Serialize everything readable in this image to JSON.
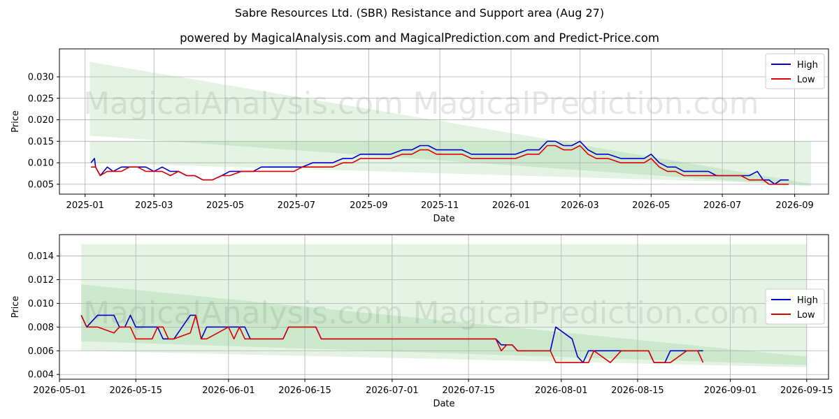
{
  "title": "Sabre Resources Ltd. (SBR) Resistance and Support area (Aug 27)",
  "subtitle": "powered by MagicalAnalysis.com and MagicalPrediction.com and Predict-Price.com",
  "watermarks": [
    "MagicalAnalysis.com",
    "MagicalPrediction.com"
  ],
  "colors": {
    "high": "#0000cc",
    "low": "#dd0000",
    "band": "#2ca02c",
    "grid": "#b0b0b0",
    "watermark": "#dddddd"
  },
  "chart_data": [
    {
      "type": "line",
      "xlabel": "Date",
      "ylabel": "Price",
      "x_type": "date",
      "xlim": [
        "2024-12-10",
        "2026-09-30"
      ],
      "ylim": [
        0.0027,
        0.0365
      ],
      "xticks": [
        "2025-01",
        "2025-03",
        "2025-05",
        "2025-07",
        "2025-09",
        "2025-11",
        "2026-01",
        "2026-03",
        "2026-05",
        "2026-07",
        "2026-09"
      ],
      "xtick_dates": [
        "2025-01-01",
        "2025-03-01",
        "2025-05-01",
        "2025-07-01",
        "2025-09-01",
        "2025-11-01",
        "2026-01-01",
        "2026-03-01",
        "2026-05-01",
        "2026-07-01",
        "2026-09-01"
      ],
      "yticks": [
        "0.005",
        "0.010",
        "0.015",
        "0.020",
        "0.025",
        "0.030"
      ],
      "ytick_values": [
        0.005,
        0.01,
        0.015,
        0.02,
        0.025,
        0.03
      ],
      "grid": true,
      "legend_position": "top-right",
      "bands": [
        {
          "x": [
            "2025-01-05",
            "2026-09-15"
          ],
          "upper": [
            0.0335,
            0.0051
          ],
          "lower": [
            0.0163,
            0.0045
          ]
        },
        {
          "x": [
            "2025-01-05",
            "2026-09-15"
          ],
          "upper": [
            0.015,
            0.015
          ],
          "lower": [
            0.01,
            0.005
          ]
        }
      ],
      "series": [
        {
          "name": "High",
          "x": [
            "2025-01-06",
            "2025-01-09",
            "2025-01-10",
            "2025-01-14",
            "2025-01-20",
            "2025-01-25",
            "2025-02-01",
            "2025-02-08",
            "2025-02-15",
            "2025-02-22",
            "2025-03-01",
            "2025-03-08",
            "2025-03-15",
            "2025-03-22",
            "2025-03-29",
            "2025-04-05",
            "2025-04-12",
            "2025-04-20",
            "2025-04-28",
            "2025-05-05",
            "2025-05-15",
            "2025-05-25",
            "2025-06-01",
            "2025-06-08",
            "2025-06-15",
            "2025-06-22",
            "2025-06-29",
            "2025-07-06",
            "2025-07-15",
            "2025-07-25",
            "2025-08-01",
            "2025-08-10",
            "2025-08-18",
            "2025-08-25",
            "2025-09-01",
            "2025-09-10",
            "2025-09-20",
            "2025-09-30",
            "2025-10-08",
            "2025-10-15",
            "2025-10-22",
            "2025-10-29",
            "2025-11-05",
            "2025-11-12",
            "2025-11-20",
            "2025-11-28",
            "2025-12-05",
            "2025-12-15",
            "2025-12-25",
            "2026-01-05",
            "2026-01-15",
            "2026-01-25",
            "2026-02-01",
            "2026-02-08",
            "2026-02-15",
            "2026-02-22",
            "2026-03-01",
            "2026-03-08",
            "2026-03-15",
            "2026-03-25",
            "2026-04-05",
            "2026-04-15",
            "2026-04-25",
            "2026-05-01",
            "2026-05-08",
            "2026-05-15",
            "2026-05-22",
            "2026-05-29",
            "2026-06-05",
            "2026-06-12",
            "2026-06-19",
            "2026-06-26",
            "2026-07-03",
            "2026-07-10",
            "2026-07-17",
            "2026-07-24",
            "2026-07-31",
            "2026-08-05",
            "2026-08-10",
            "2026-08-15",
            "2026-08-20",
            "2026-08-27"
          ],
          "y": [
            0.01,
            0.011,
            0.009,
            0.007,
            0.009,
            0.008,
            0.009,
            0.009,
            0.009,
            0.009,
            0.008,
            0.009,
            0.008,
            0.008,
            0.007,
            0.007,
            0.006,
            0.006,
            0.007,
            0.008,
            0.008,
            0.008,
            0.009,
            0.009,
            0.009,
            0.009,
            0.009,
            0.009,
            0.01,
            0.01,
            0.01,
            0.011,
            0.011,
            0.012,
            0.012,
            0.012,
            0.012,
            0.013,
            0.013,
            0.014,
            0.014,
            0.013,
            0.013,
            0.013,
            0.013,
            0.012,
            0.012,
            0.012,
            0.012,
            0.012,
            0.013,
            0.013,
            0.015,
            0.015,
            0.014,
            0.014,
            0.015,
            0.013,
            0.012,
            0.012,
            0.011,
            0.011,
            0.011,
            0.012,
            0.01,
            0.009,
            0.009,
            0.008,
            0.008,
            0.008,
            0.008,
            0.007,
            0.007,
            0.007,
            0.007,
            0.007,
            0.008,
            0.006,
            0.006,
            0.005,
            0.006,
            0.006
          ]
        },
        {
          "name": "Low",
          "x": [
            "2025-01-06",
            "2025-01-09",
            "2025-01-10",
            "2025-01-14",
            "2025-01-20",
            "2025-01-25",
            "2025-02-01",
            "2025-02-08",
            "2025-02-15",
            "2025-02-22",
            "2025-03-01",
            "2025-03-08",
            "2025-03-15",
            "2025-03-22",
            "2025-03-29",
            "2025-04-05",
            "2025-04-12",
            "2025-04-20",
            "2025-04-28",
            "2025-05-05",
            "2025-05-15",
            "2025-05-25",
            "2025-06-01",
            "2025-06-08",
            "2025-06-15",
            "2025-06-22",
            "2025-06-29",
            "2025-07-06",
            "2025-07-15",
            "2025-07-25",
            "2025-08-01",
            "2025-08-10",
            "2025-08-18",
            "2025-08-25",
            "2025-09-01",
            "2025-09-10",
            "2025-09-20",
            "2025-09-30",
            "2025-10-08",
            "2025-10-15",
            "2025-10-22",
            "2025-10-29",
            "2025-11-05",
            "2025-11-12",
            "2025-11-20",
            "2025-11-28",
            "2025-12-05",
            "2025-12-15",
            "2025-12-25",
            "2026-01-05",
            "2026-01-15",
            "2026-01-25",
            "2026-02-01",
            "2026-02-08",
            "2026-02-15",
            "2026-02-22",
            "2026-03-01",
            "2026-03-08",
            "2026-03-15",
            "2026-03-25",
            "2026-04-05",
            "2026-04-15",
            "2026-04-25",
            "2026-05-01",
            "2026-05-08",
            "2026-05-15",
            "2026-05-22",
            "2026-05-29",
            "2026-06-05",
            "2026-06-12",
            "2026-06-19",
            "2026-06-26",
            "2026-07-03",
            "2026-07-10",
            "2026-07-17",
            "2026-07-24",
            "2026-07-31",
            "2026-08-05",
            "2026-08-10",
            "2026-08-15",
            "2026-08-20",
            "2026-08-27"
          ],
          "y": [
            0.009,
            0.009,
            0.009,
            0.007,
            0.008,
            0.008,
            0.008,
            0.009,
            0.009,
            0.008,
            0.008,
            0.008,
            0.007,
            0.008,
            0.007,
            0.007,
            0.006,
            0.006,
            0.007,
            0.007,
            0.008,
            0.008,
            0.008,
            0.008,
            0.008,
            0.008,
            0.008,
            0.009,
            0.009,
            0.009,
            0.009,
            0.01,
            0.01,
            0.011,
            0.011,
            0.011,
            0.011,
            0.012,
            0.012,
            0.013,
            0.013,
            0.012,
            0.012,
            0.012,
            0.012,
            0.011,
            0.011,
            0.011,
            0.011,
            0.011,
            0.012,
            0.012,
            0.014,
            0.014,
            0.013,
            0.013,
            0.014,
            0.012,
            0.011,
            0.011,
            0.01,
            0.01,
            0.01,
            0.011,
            0.009,
            0.008,
            0.008,
            0.007,
            0.007,
            0.007,
            0.007,
            0.007,
            0.007,
            0.007,
            0.007,
            0.006,
            0.006,
            0.006,
            0.005,
            0.005,
            0.005,
            0.005
          ]
        }
      ]
    },
    {
      "type": "line",
      "xlabel": "Date",
      "ylabel": "Price",
      "x_type": "date",
      "xlim": [
        "2026-05-01",
        "2026-09-19"
      ],
      "ylim": [
        0.0036,
        0.0158
      ],
      "xticks": [
        "2026-05-01",
        "2026-05-15",
        "2026-06-01",
        "2026-06-15",
        "2026-07-01",
        "2026-07-15",
        "2026-08-01",
        "2026-08-15",
        "2026-09-01",
        "2026-09-15"
      ],
      "yticks": [
        "0.004",
        "0.006",
        "0.008",
        "0.010",
        "0.012",
        "0.014"
      ],
      "ytick_values": [
        0.004,
        0.006,
        0.008,
        0.01,
        0.012,
        0.014
      ],
      "grid": true,
      "legend_position": "center-right",
      "bands": [
        {
          "x": [
            "2026-05-05",
            "2026-09-15"
          ],
          "upper": [
            0.015,
            0.015
          ],
          "lower": [
            0.006,
            0.0046
          ]
        },
        {
          "x": [
            "2026-05-05",
            "2026-09-15"
          ],
          "upper": [
            0.0116,
            0.0055
          ],
          "lower": [
            0.0068,
            0.0048
          ]
        }
      ],
      "series": [
        {
          "name": "High",
          "x": [
            "2026-05-05",
            "2026-05-06",
            "2026-05-08",
            "2026-05-11",
            "2026-05-12",
            "2026-05-13",
            "2026-05-14",
            "2026-05-15",
            "2026-05-18",
            "2026-05-19",
            "2026-05-20",
            "2026-05-21",
            "2026-05-22",
            "2026-05-25",
            "2026-05-26",
            "2026-05-27",
            "2026-05-28",
            "2026-06-01",
            "2026-06-02",
            "2026-06-03",
            "2026-06-04",
            "2026-06-05",
            "2026-06-08",
            "2026-06-09",
            "2026-06-10",
            "2026-06-11",
            "2026-06-12",
            "2026-06-15",
            "2026-06-16",
            "2026-06-17",
            "2026-06-18",
            "2026-06-19",
            "2026-06-22",
            "2026-06-23",
            "2026-06-24",
            "2026-06-25",
            "2026-06-26",
            "2026-06-29",
            "2026-06-30",
            "2026-07-01",
            "2026-07-02",
            "2026-07-03",
            "2026-07-06",
            "2026-07-07",
            "2026-07-08",
            "2026-07-09",
            "2026-07-10",
            "2026-07-13",
            "2026-07-14",
            "2026-07-15",
            "2026-07-16",
            "2026-07-17",
            "2026-07-20",
            "2026-07-21",
            "2026-07-22",
            "2026-07-23",
            "2026-07-24",
            "2026-07-27",
            "2026-07-28",
            "2026-07-29",
            "2026-07-30",
            "2026-07-31",
            "2026-08-03",
            "2026-08-04",
            "2026-08-05",
            "2026-08-06",
            "2026-08-07",
            "2026-08-10",
            "2026-08-11",
            "2026-08-12",
            "2026-08-13",
            "2026-08-14",
            "2026-08-17",
            "2026-08-18",
            "2026-08-19",
            "2026-08-20",
            "2026-08-21",
            "2026-08-24",
            "2026-08-25",
            "2026-08-26",
            "2026-08-27"
          ],
          "y": [
            0.009,
            0.008,
            0.009,
            0.009,
            0.008,
            0.008,
            0.009,
            0.008,
            0.008,
            0.008,
            0.007,
            0.007,
            0.007,
            0.009,
            0.009,
            0.007,
            0.008,
            0.008,
            0.008,
            0.008,
            0.008,
            0.007,
            0.007,
            0.007,
            0.007,
            0.007,
            0.008,
            0.008,
            0.008,
            0.008,
            0.007,
            0.007,
            0.007,
            0.007,
            0.007,
            0.007,
            0.007,
            0.007,
            0.007,
            0.007,
            0.007,
            0.007,
            0.007,
            0.007,
            0.007,
            0.007,
            0.007,
            0.007,
            0.007,
            0.007,
            0.007,
            0.007,
            0.007,
            0.0065,
            0.0065,
            0.0065,
            0.006,
            0.006,
            0.006,
            0.006,
            0.006,
            0.008,
            0.007,
            0.0055,
            0.005,
            0.006,
            0.006,
            0.006,
            0.006,
            0.006,
            0.006,
            0.006,
            0.006,
            0.005,
            0.005,
            0.005,
            0.006,
            0.006,
            0.006,
            0.006,
            0.006
          ]
        },
        {
          "name": "Low",
          "x": [
            "2026-05-05",
            "2026-05-06",
            "2026-05-08",
            "2026-05-11",
            "2026-05-12",
            "2026-05-13",
            "2026-05-14",
            "2026-05-15",
            "2026-05-18",
            "2026-05-19",
            "2026-05-20",
            "2026-05-21",
            "2026-05-22",
            "2026-05-25",
            "2026-05-26",
            "2026-05-27",
            "2026-05-28",
            "2026-06-01",
            "2026-06-02",
            "2026-06-03",
            "2026-06-04",
            "2026-06-05",
            "2026-06-08",
            "2026-06-09",
            "2026-06-10",
            "2026-06-11",
            "2026-06-12",
            "2026-06-15",
            "2026-06-16",
            "2026-06-17",
            "2026-06-18",
            "2026-06-19",
            "2026-06-22",
            "2026-06-23",
            "2026-06-24",
            "2026-06-25",
            "2026-06-26",
            "2026-06-29",
            "2026-06-30",
            "2026-07-01",
            "2026-07-02",
            "2026-07-03",
            "2026-07-06",
            "2026-07-07",
            "2026-07-08",
            "2026-07-09",
            "2026-07-10",
            "2026-07-13",
            "2026-07-14",
            "2026-07-15",
            "2026-07-16",
            "2026-07-17",
            "2026-07-20",
            "2026-07-21",
            "2026-07-22",
            "2026-07-23",
            "2026-07-24",
            "2026-07-27",
            "2026-07-28",
            "2026-07-29",
            "2026-07-30",
            "2026-07-31",
            "2026-08-03",
            "2026-08-04",
            "2026-08-05",
            "2026-08-06",
            "2026-08-07",
            "2026-08-10",
            "2026-08-11",
            "2026-08-12",
            "2026-08-13",
            "2026-08-14",
            "2026-08-17",
            "2026-08-18",
            "2026-08-19",
            "2026-08-20",
            "2026-08-21",
            "2026-08-24",
            "2026-08-25",
            "2026-08-26",
            "2026-08-27"
          ],
          "y": [
            0.009,
            0.008,
            0.008,
            0.0075,
            0.008,
            0.008,
            0.008,
            0.007,
            0.007,
            0.008,
            0.008,
            0.007,
            0.007,
            0.0075,
            0.009,
            0.007,
            0.007,
            0.008,
            0.007,
            0.008,
            0.007,
            0.007,
            0.007,
            0.007,
            0.007,
            0.007,
            0.008,
            0.008,
            0.008,
            0.008,
            0.007,
            0.007,
            0.007,
            0.007,
            0.007,
            0.007,
            0.007,
            0.007,
            0.007,
            0.007,
            0.007,
            0.007,
            0.007,
            0.007,
            0.007,
            0.007,
            0.007,
            0.007,
            0.007,
            0.007,
            0.007,
            0.007,
            0.007,
            0.006,
            0.0065,
            0.0065,
            0.006,
            0.006,
            0.006,
            0.006,
            0.006,
            0.005,
            0.005,
            0.005,
            0.005,
            0.005,
            0.006,
            0.005,
            0.0055,
            0.006,
            0.006,
            0.006,
            0.006,
            0.005,
            0.005,
            0.005,
            0.005,
            0.006,
            0.006,
            0.006,
            0.005
          ]
        }
      ]
    }
  ]
}
